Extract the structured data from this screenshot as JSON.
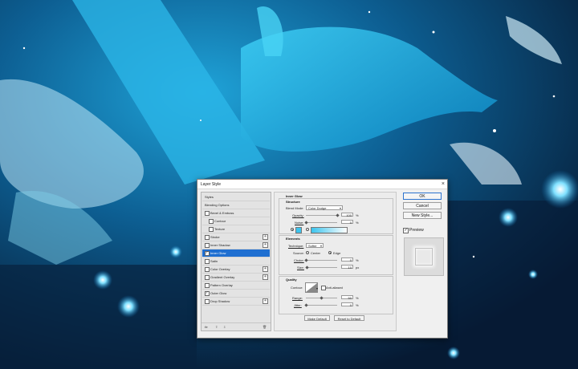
{
  "dialog": {
    "title": "Layer Style",
    "close_glyph": "×"
  },
  "sidebar": {
    "header": "Styles",
    "items": [
      {
        "label": "Blending Options",
        "checkbox": false
      },
      {
        "label": "Bevel & Emboss",
        "checkbox": true,
        "checked": false
      },
      {
        "label": "Contour",
        "checkbox": true,
        "checked": false,
        "indent": true
      },
      {
        "label": "Texture",
        "checkbox": true,
        "checked": false,
        "indent": true
      },
      {
        "label": "Stroke",
        "checkbox": true,
        "checked": false,
        "plus": true
      },
      {
        "label": "Inner Shadow",
        "checkbox": true,
        "checked": false,
        "plus": true
      },
      {
        "label": "Inner Glow",
        "checkbox": true,
        "checked": true,
        "selected": true
      },
      {
        "label": "Satin",
        "checkbox": true,
        "checked": false
      },
      {
        "label": "Color Overlay",
        "checkbox": true,
        "checked": false,
        "plus": true
      },
      {
        "label": "Gradient Overlay",
        "checkbox": true,
        "checked": false,
        "plus": true
      },
      {
        "label": "Pattern Overlay",
        "checkbox": true,
        "checked": false
      },
      {
        "label": "Outer Glow",
        "checkbox": true,
        "checked": true
      },
      {
        "label": "Drop Shadow",
        "checkbox": true,
        "checked": false,
        "plus": true
      }
    ],
    "footer": {
      "fx": "fx",
      "up": "⇧",
      "down": "⇩",
      "trash": "🗑"
    }
  },
  "inner_glow": {
    "title": "Inner Glow",
    "structure": {
      "title": "Structure",
      "blend_mode_label": "Blend Mode:",
      "blend_mode": "Color Dodge",
      "opacity_label": "Opacity:",
      "opacity": "100",
      "opacity_fraction": 1.0,
      "noise_label": "Noise:",
      "noise": "0",
      "noise_fraction": 0.0,
      "unit": "%",
      "glow_color": "#3bc4ee",
      "gradient_start": "#3bc4ee",
      "gradient_end": "#ffffff"
    },
    "elements": {
      "title": "Elements",
      "technique_label": "Technique:",
      "technique": "Softer",
      "source_label": "Source:",
      "source_center": "Center",
      "source_edge": "Edge",
      "source_selected": "Edge",
      "choke_label": "Choke:",
      "choke": "0",
      "choke_fraction": 0.0,
      "choke_unit": "%",
      "size_label": "Size:",
      "size": "10",
      "size_fraction": 0.04,
      "size_unit": "px"
    },
    "quality": {
      "title": "Quality",
      "contour_label": "Contour:",
      "anti_aliased_label": "Anti-aliased",
      "anti_aliased": false,
      "range_label": "Range:",
      "range": "50",
      "range_fraction": 0.5,
      "range_unit": "%",
      "jitter_label": "Jitter:",
      "jitter": "0",
      "jitter_fraction": 0.0,
      "jitter_unit": "%"
    },
    "make_default": "Make Default",
    "reset_default": "Reset to Default"
  },
  "buttons": {
    "ok": "OK",
    "cancel": "Cancel",
    "new_style": "New Style...",
    "preview": "Preview",
    "preview_checked": true
  }
}
